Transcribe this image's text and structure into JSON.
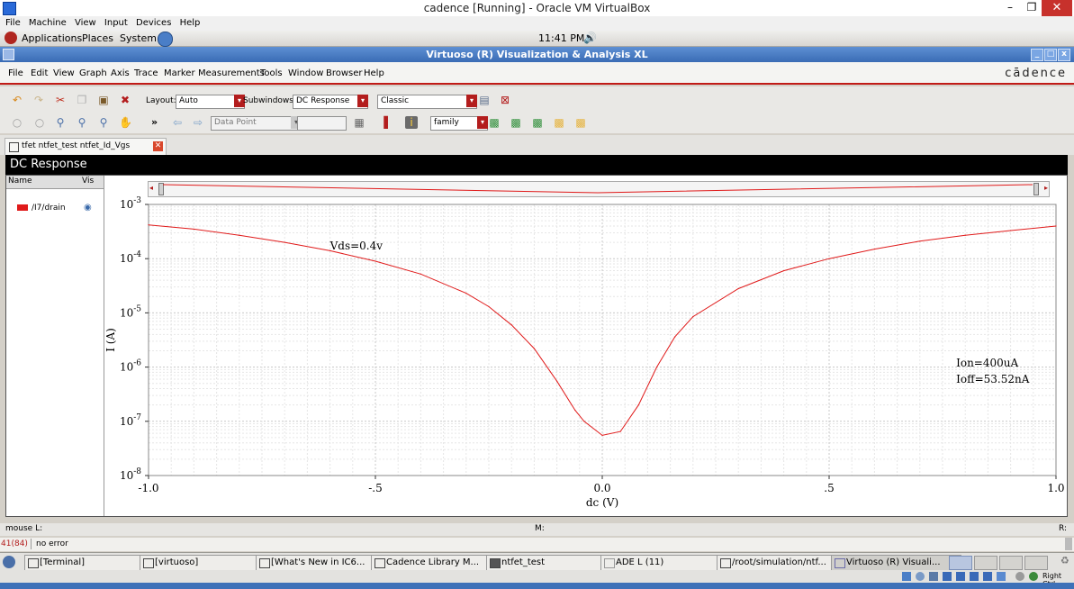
{
  "host_window": {
    "title": "cadence [Running] - Oracle VM VirtualBox",
    "menu": [
      "File",
      "Machine",
      "View",
      "Input",
      "Devices",
      "Help"
    ],
    "min": "–",
    "max": "❐",
    "close": "✕"
  },
  "gnome_panel": {
    "applications": "Applications",
    "places": "Places",
    "system": "System",
    "clock": "11:41 PM"
  },
  "app": {
    "title": "Virtuoso (R) Visualization & Analysis XL",
    "menu": [
      "File",
      "Edit",
      "View",
      "Graph",
      "Axis",
      "Trace",
      "Marker",
      "Measurements",
      "Tools",
      "Window",
      "Browser",
      "Help"
    ],
    "logo": "cādence"
  },
  "toolbar1": {
    "layout_label": "Layout:",
    "layout_value": "Auto",
    "subwindows_label": "Subwindows",
    "subwindows_value": "DC Response",
    "style_value": "Classic"
  },
  "toolbar2": {
    "more": "»",
    "data_point": "Data Point",
    "family_value": "family"
  },
  "tab": {
    "label": "tfet ntfet_test ntfet_Id_Vgs"
  },
  "plot_window": {
    "title": "DC Response",
    "name_header": "Name",
    "vis_header": "Vis",
    "trace_name": "/I7/drain",
    "trace_color": "#e01a1a"
  },
  "chart_data": {
    "type": "line",
    "xlabel": "dc (V)",
    "ylabel": "I (A)",
    "xlim": [
      -1.0,
      1.0
    ],
    "ylim": [
      1e-08,
      0.001
    ],
    "yscale": "log",
    "grid": true,
    "x_tick_labels": [
      "-1.0",
      "-.5",
      "0.0",
      ".5",
      "1.0"
    ],
    "y_tick_labels": [
      {
        "base": "10",
        "exp": "-3"
      },
      {
        "base": "10",
        "exp": "-4"
      },
      {
        "base": "10",
        "exp": "-5"
      },
      {
        "base": "10",
        "exp": "-6"
      },
      {
        "base": "10",
        "exp": "-7"
      },
      {
        "base": "10",
        "exp": "-8"
      }
    ],
    "series": [
      {
        "name": "/I7/drain",
        "color": "#e01a1a",
        "x": [
          -1.0,
          -0.9,
          -0.8,
          -0.7,
          -0.6,
          -0.5,
          -0.4,
          -0.3,
          -0.25,
          -0.2,
          -0.15,
          -0.1,
          -0.06,
          -0.04,
          0.0,
          0.04,
          0.08,
          0.12,
          0.16,
          0.2,
          0.3,
          0.4,
          0.5,
          0.6,
          0.7,
          0.8,
          0.9,
          1.0
        ],
        "y": [
          0.00042,
          0.00035,
          0.00027,
          0.0002,
          0.00014,
          9e-05,
          5.2e-05,
          2.3e-05,
          1.3e-05,
          6e-06,
          2.2e-06,
          5.5e-07,
          1.6e-07,
          1e-07,
          5.5e-08,
          6.5e-08,
          2e-07,
          1e-06,
          3.6e-06,
          8.5e-06,
          2.8e-05,
          6e-05,
          0.0001,
          0.00015,
          0.00021,
          0.00027,
          0.00033,
          0.0004
        ]
      }
    ],
    "annotations": [
      "Vds=0.4v",
      "Ion=400uA",
      "Ioff=53.52nA"
    ]
  },
  "status": {
    "mouse": "mouse L:",
    "middle": "M:",
    "right": "R:",
    "line_no": "41(84)",
    "message": "no error"
  },
  "taskbar": [
    {
      "label": "[Terminal]"
    },
    {
      "label": "[virtuoso]"
    },
    {
      "label": "[What's New in IC6..."
    },
    {
      "label": "Cadence Library M..."
    },
    {
      "label": "ntfet_test"
    },
    {
      "label": "ADE L (11)"
    },
    {
      "label": "/root/simulation/ntf..."
    },
    {
      "label": "Virtuoso (R) Visuali..."
    }
  ],
  "systray": {
    "right_ctrl": "Right Ctrl"
  }
}
